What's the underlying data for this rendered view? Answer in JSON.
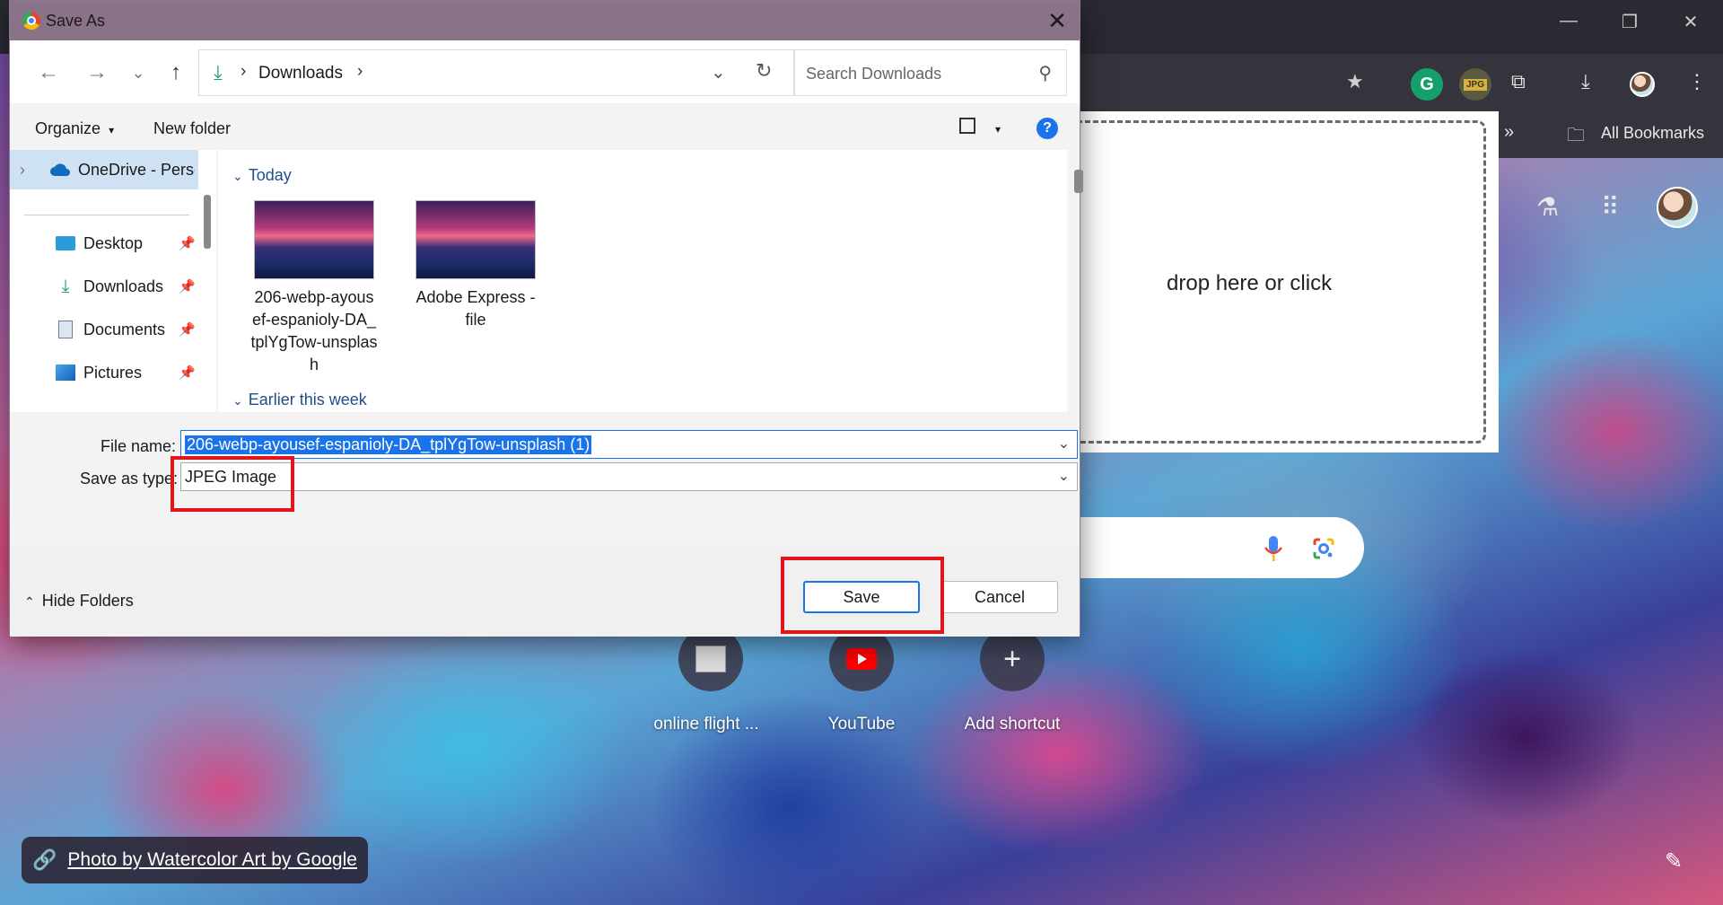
{
  "dialog": {
    "title": "Save As",
    "close_glyph": "✕",
    "address": {
      "location": "Downloads"
    },
    "search": {
      "placeholder": "Search Downloads"
    },
    "commands": {
      "organize": "Organize",
      "organize_caret": "▾",
      "new_folder": "New folder",
      "help": "?"
    },
    "nav_pane": {
      "items": [
        {
          "label": "OneDrive - Perso",
          "icon": "cloud-icon"
        },
        {
          "label": "Desktop",
          "icon": "desktop-icon"
        },
        {
          "label": "Downloads",
          "icon": "download-icon"
        },
        {
          "label": "Documents",
          "icon": "document-icon"
        },
        {
          "label": "Pictures",
          "icon": "pictures-icon"
        }
      ]
    },
    "content": {
      "groups": [
        {
          "label": "Today"
        },
        {
          "label": "Earlier this week"
        }
      ],
      "files": [
        {
          "label": "206-webp-ayousef-espanioly-DA_tplYgTow-unsplash",
          "lines": [
            "206-webp-ayous",
            "ef-espanioly-DA_",
            "tplYgTow-unsplas",
            "h"
          ]
        },
        {
          "label": "Adobe Express - file",
          "lines": [
            "Adobe Express -",
            "file"
          ]
        }
      ]
    },
    "form": {
      "file_name_label": "File name:",
      "file_name_value": "206-webp-ayousef-espanioly-DA_tplYgTow-unsplash (1)",
      "save_type_label": "Save as type:",
      "save_type_value": "JPEG Image"
    },
    "footer": {
      "hide_folders": "Hide Folders",
      "save": "Save",
      "cancel": "Cancel"
    }
  },
  "browser": {
    "bookmarks_more": "»",
    "all_bookmarks": "All Bookmarks",
    "dropzone_text": "drop here or click",
    "extension_badge": "JPG",
    "shortcuts": [
      {
        "label": "online flight ...",
        "icon": "site-favicon"
      },
      {
        "label": "YouTube",
        "icon": "youtube-icon"
      },
      {
        "label": "Add shortcut",
        "icon": "plus-icon"
      }
    ],
    "photo_credit": "Photo by Watercolor Art by Google"
  },
  "colors": {
    "highlight": "#e0161a",
    "accent": "#1a73e8",
    "dialog_title_bar": "#8a7388"
  }
}
